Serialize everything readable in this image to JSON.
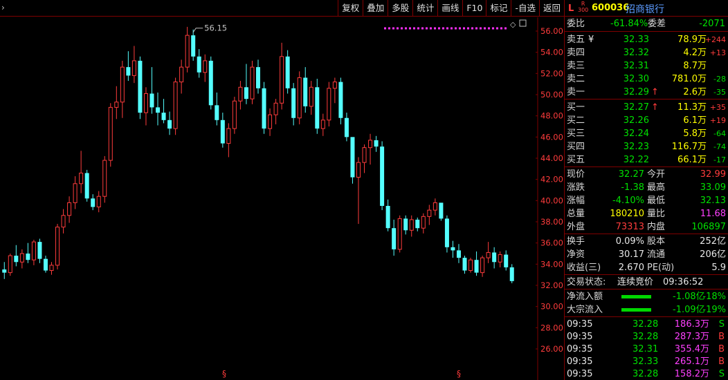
{
  "toolbar": {
    "arrow": "›",
    "buttons": [
      "复权",
      "叠加",
      "多股",
      "统计",
      "画线",
      "F10",
      "标记",
      "-自选",
      "返回"
    ]
  },
  "chart": {
    "y_ticks": [
      "56.00",
      "54.00",
      "52.00",
      "50.00",
      "48.00",
      "46.00",
      "44.00",
      "42.00",
      "40.00",
      "38.00",
      "36.00",
      "34.00",
      "32.00",
      "30.00",
      "28.00",
      "26.00"
    ],
    "max_label": "56.15",
    "dividend_marker": "§"
  },
  "chart_data": {
    "type": "candlestick",
    "ylim": [
      25,
      57.5
    ],
    "up_color": "#ff3c3c",
    "down_color": "#54ffff",
    "max_price": 56.15,
    "candles": [
      [
        33.5,
        34.2,
        32.6,
        33.2
      ],
      [
        33.2,
        35.0,
        32.9,
        34.8
      ],
      [
        34.8,
        35.8,
        33.8,
        34.2
      ],
      [
        34.2,
        35.4,
        33.6,
        35.0
      ],
      [
        35.0,
        36.0,
        34.1,
        34.4
      ],
      [
        34.4,
        36.3,
        33.9,
        36.1
      ],
      [
        36.1,
        36.4,
        34.1,
        34.5
      ],
      [
        34.5,
        34.8,
        33.2,
        33.4
      ],
      [
        33.4,
        34.2,
        33.0,
        33.9
      ],
      [
        33.9,
        37.8,
        33.5,
        37.5
      ],
      [
        37.5,
        39.2,
        36.9,
        38.6
      ],
      [
        38.6,
        40.4,
        37.9,
        39.8
      ],
      [
        39.8,
        42.3,
        39.2,
        41.6
      ],
      [
        41.6,
        44.7,
        40.7,
        42.6
      ],
      [
        42.6,
        42.9,
        39.9,
        40.2
      ],
      [
        40.2,
        40.6,
        39.1,
        39.4
      ],
      [
        39.4,
        40.9,
        38.9,
        40.4
      ],
      [
        40.4,
        44.2,
        39.8,
        43.8
      ],
      [
        43.8,
        49.2,
        43.2,
        48.8
      ],
      [
        48.8,
        50.8,
        47.7,
        49.3
      ],
      [
        49.3,
        53.2,
        47.8,
        52.6
      ],
      [
        52.6,
        54.1,
        51.3,
        51.8
      ],
      [
        51.8,
        54.6,
        51.1,
        53.2
      ],
      [
        53.2,
        53.6,
        47.7,
        48.3
      ],
      [
        48.3,
        50.7,
        47.1,
        50.1
      ],
      [
        50.1,
        52.6,
        48.2,
        48.8
      ],
      [
        48.8,
        50.2,
        47.1,
        48.3
      ],
      [
        48.3,
        49.6,
        47.3,
        47.6
      ],
      [
        47.6,
        48.4,
        46.2,
        46.8
      ],
      [
        46.8,
        51.6,
        46.2,
        51.2
      ],
      [
        51.2,
        53.3,
        50.1,
        52.6
      ],
      [
        52.6,
        56.4,
        52.1,
        55.6
      ],
      [
        55.6,
        56.15,
        53.2,
        53.6
      ],
      [
        53.6,
        54.3,
        51.6,
        52.1
      ],
      [
        52.1,
        53.8,
        51.2,
        53.2
      ],
      [
        53.2,
        53.6,
        48.6,
        49.0
      ],
      [
        49.0,
        50.2,
        47.1,
        47.6
      ],
      [
        47.6,
        48.3,
        45.0,
        45.4
      ],
      [
        45.4,
        47.3,
        44.1,
        46.8
      ],
      [
        46.8,
        49.8,
        46.3,
        49.4
      ],
      [
        49.4,
        51.3,
        48.6,
        50.7
      ],
      [
        50.7,
        52.9,
        49.1,
        49.6
      ],
      [
        49.6,
        53.2,
        49.1,
        52.6
      ],
      [
        52.6,
        53.3,
        50.1,
        50.6
      ],
      [
        50.6,
        51.2,
        46.3,
        46.8
      ],
      [
        46.8,
        48.7,
        46.1,
        48.1
      ],
      [
        48.1,
        49.6,
        47.2,
        49.2
      ],
      [
        49.2,
        54.9,
        48.6,
        53.6
      ],
      [
        53.6,
        54.2,
        50.1,
        50.6
      ],
      [
        50.6,
        51.1,
        47.1,
        47.8
      ],
      [
        47.8,
        52.2,
        47.2,
        51.6
      ],
      [
        51.6,
        52.6,
        48.3,
        48.9
      ],
      [
        48.9,
        51.3,
        48.1,
        50.7
      ],
      [
        50.7,
        51.5,
        46.3,
        46.8
      ],
      [
        46.8,
        48.2,
        46.1,
        47.6
      ],
      [
        47.6,
        51.2,
        47.0,
        50.6
      ],
      [
        50.6,
        51.6,
        49.2,
        51.2
      ],
      [
        51.2,
        51.6,
        47.2,
        47.8
      ],
      [
        47.8,
        48.3,
        45.6,
        46.0
      ],
      [
        46.0,
        45.4,
        41.6,
        42.2
      ],
      [
        42.2,
        44.1,
        37.8,
        43.6
      ],
      [
        43.6,
        45.3,
        42.6,
        45.0
      ],
      [
        45.0,
        46.3,
        43.4,
        45.7
      ],
      [
        45.7,
        46.1,
        44.6,
        45.1
      ],
      [
        45.1,
        45.6,
        39.1,
        39.5
      ],
      [
        39.5,
        40.1,
        37.1,
        37.4
      ],
      [
        37.4,
        38.2,
        34.8,
        35.4
      ],
      [
        35.4,
        38.6,
        35.1,
        38.3
      ],
      [
        38.3,
        38.6,
        36.8,
        37.2
      ],
      [
        37.2,
        38.6,
        36.6,
        38.2
      ],
      [
        38.2,
        38.4,
        37.1,
        37.4
      ],
      [
        37.4,
        38.8,
        36.9,
        38.5
      ],
      [
        38.5,
        39.6,
        37.7,
        39.1
      ],
      [
        39.1,
        40.2,
        38.6,
        39.8
      ],
      [
        39.8,
        39.6,
        38.1,
        38.3
      ],
      [
        38.3,
        38.6,
        35.1,
        35.6
      ],
      [
        35.6,
        36.2,
        34.6,
        35.3
      ],
      [
        35.3,
        35.9,
        34.1,
        34.6
      ],
      [
        34.6,
        34.8,
        33.1,
        33.4
      ],
      [
        33.4,
        34.6,
        33.2,
        34.4
      ],
      [
        34.4,
        35.2,
        32.9,
        33.2
      ],
      [
        33.2,
        34.8,
        32.8,
        34.6
      ],
      [
        34.6,
        36.1,
        34.1,
        35.1
      ],
      [
        35.1,
        35.6,
        33.6,
        34.2
      ],
      [
        34.2,
        35.2,
        33.7,
        34.9
      ],
      [
        34.9,
        35.3,
        33.4,
        33.7
      ],
      [
        33.7,
        34.0,
        32.2,
        32.4
      ]
    ]
  },
  "panel": {
    "header": {
      "L": "L",
      "R": "R",
      "sub": "300",
      "code": "600036",
      "name": "招商银行"
    },
    "weibi": {
      "label": "委比",
      "value": "-61.84%",
      "label2": "委差",
      "value2": "-2071"
    },
    "sell": [
      {
        "label": "卖五",
        "mark": "¥",
        "price": "32.33",
        "vol": "78.9",
        "unit": "万",
        "chg": "+244",
        "arrow": ""
      },
      {
        "label": "卖四",
        "mark": "",
        "price": "32.32",
        "vol": "4.2",
        "unit": "万",
        "chg": "+13",
        "arrow": ""
      },
      {
        "label": "卖三",
        "mark": "",
        "price": "32.31",
        "vol": "8.7",
        "unit": "万",
        "chg": "",
        "arrow": ""
      },
      {
        "label": "卖二",
        "mark": "",
        "price": "32.30",
        "vol": "781.0",
        "unit": "万",
        "chg": "-28",
        "arrow": ""
      },
      {
        "label": "卖一",
        "mark": "",
        "price": "32.29",
        "vol": "2.6",
        "unit": "万",
        "chg": "-35",
        "arrow": "↑"
      }
    ],
    "buy": [
      {
        "label": "买一",
        "price": "32.27",
        "vol": "11.3",
        "unit": "万",
        "chg": "+35",
        "arrow": "↑"
      },
      {
        "label": "买二",
        "price": "32.26",
        "vol": "6.1",
        "unit": "万",
        "chg": "+19",
        "arrow": ""
      },
      {
        "label": "买三",
        "price": "32.24",
        "vol": "5.8",
        "unit": "万",
        "chg": "-64",
        "arrow": ""
      },
      {
        "label": "买四",
        "price": "32.23",
        "vol": "116.7",
        "unit": "万",
        "chg": "-74",
        "arrow": ""
      },
      {
        "label": "买五",
        "price": "32.22",
        "vol": "66.1",
        "unit": "万",
        "chg": "-17",
        "arrow": ""
      }
    ],
    "quote": {
      "xianjia_l": "现价",
      "xianjia": "32.27",
      "jinkai_l": "今开",
      "jinkai": "32.99",
      "zhangdie_l": "涨跌",
      "zhangdie": "-1.38",
      "zuigao_l": "最高",
      "zuigao": "33.09",
      "zhangfu_l": "涨幅",
      "zhangfu": "-4.10%",
      "zuidi_l": "最低",
      "zuidi": "32.13",
      "zongliang_l": "总量",
      "zongliang": "180210",
      "liangbi_l": "量比",
      "liangbi": "11.68",
      "waipan_l": "外盘",
      "waipan": "73313",
      "neipan_l": "内盘",
      "neipan": "106897"
    },
    "stats": {
      "huanshou_l": "换手",
      "huanshou": "0.09%",
      "guben_l": "股本",
      "guben": "252亿",
      "jingzi_l": "净资",
      "jingzi": "30.17",
      "liutong_l": "流通",
      "liutong": "206亿",
      "shouyi_l": "收益(三)",
      "shouyi": "2.670",
      "pe_l": "PE(动)",
      "pe": "5.9"
    },
    "status": {
      "label": "交易状态:",
      "value": "连续竞价",
      "time": "09:36:52"
    },
    "flows": [
      {
        "label": "净流入额",
        "value": "-1.08亿",
        "pct": "-18%",
        "level": 0.85
      },
      {
        "label": "大宗流入",
        "value": "-1.09亿",
        "pct": "-19%",
        "level": 0.85
      }
    ],
    "ticks": [
      {
        "time": "09:35",
        "price": "32.28",
        "vol": "186.3",
        "unit": "万",
        "side": "S"
      },
      {
        "time": "09:35",
        "price": "32.28",
        "vol": "287.3",
        "unit": "万",
        "side": "B"
      },
      {
        "time": "09:35",
        "price": "32.31",
        "vol": "355.4",
        "unit": "万",
        "side": "B"
      },
      {
        "time": "09:35",
        "price": "32.33",
        "vol": "265.1",
        "unit": "万",
        "side": "B"
      },
      {
        "time": "09:35",
        "price": "32.28",
        "vol": "158.2",
        "unit": "万",
        "side": "S"
      }
    ]
  }
}
